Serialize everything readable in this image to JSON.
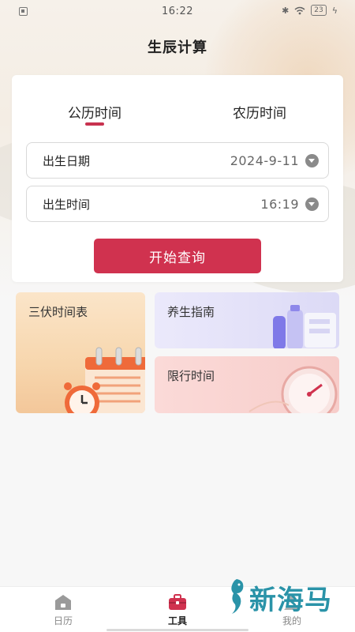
{
  "status_bar": {
    "time": "16:22",
    "battery": "23"
  },
  "header": {
    "title": "生辰计算"
  },
  "tabs": [
    {
      "label": "公历时间",
      "active": true
    },
    {
      "label": "农历时间",
      "active": false
    }
  ],
  "fields": {
    "birth_date": {
      "label": "出生日期",
      "value": "2024-9-11"
    },
    "birth_time": {
      "label": "出生时间",
      "value": "16:19"
    }
  },
  "query_button": {
    "label": "开始查询"
  },
  "tools": {
    "sanfu": {
      "label": "三伏时间表"
    },
    "yangsheng": {
      "label": "养生指南"
    },
    "xianxing": {
      "label": "限行时间"
    }
  },
  "bottom_nav": [
    {
      "label": "日历",
      "icon": "calendar-home-icon",
      "active": false
    },
    {
      "label": "工具",
      "icon": "toolbox-icon",
      "active": true
    },
    {
      "label": "我的",
      "icon": "profile-icon",
      "active": false
    }
  ],
  "watermark": {
    "text": "新海马"
  },
  "colors": {
    "accent": "#d0324f",
    "tab_underline": "#c8324f",
    "watermark": "#2a93a8"
  }
}
